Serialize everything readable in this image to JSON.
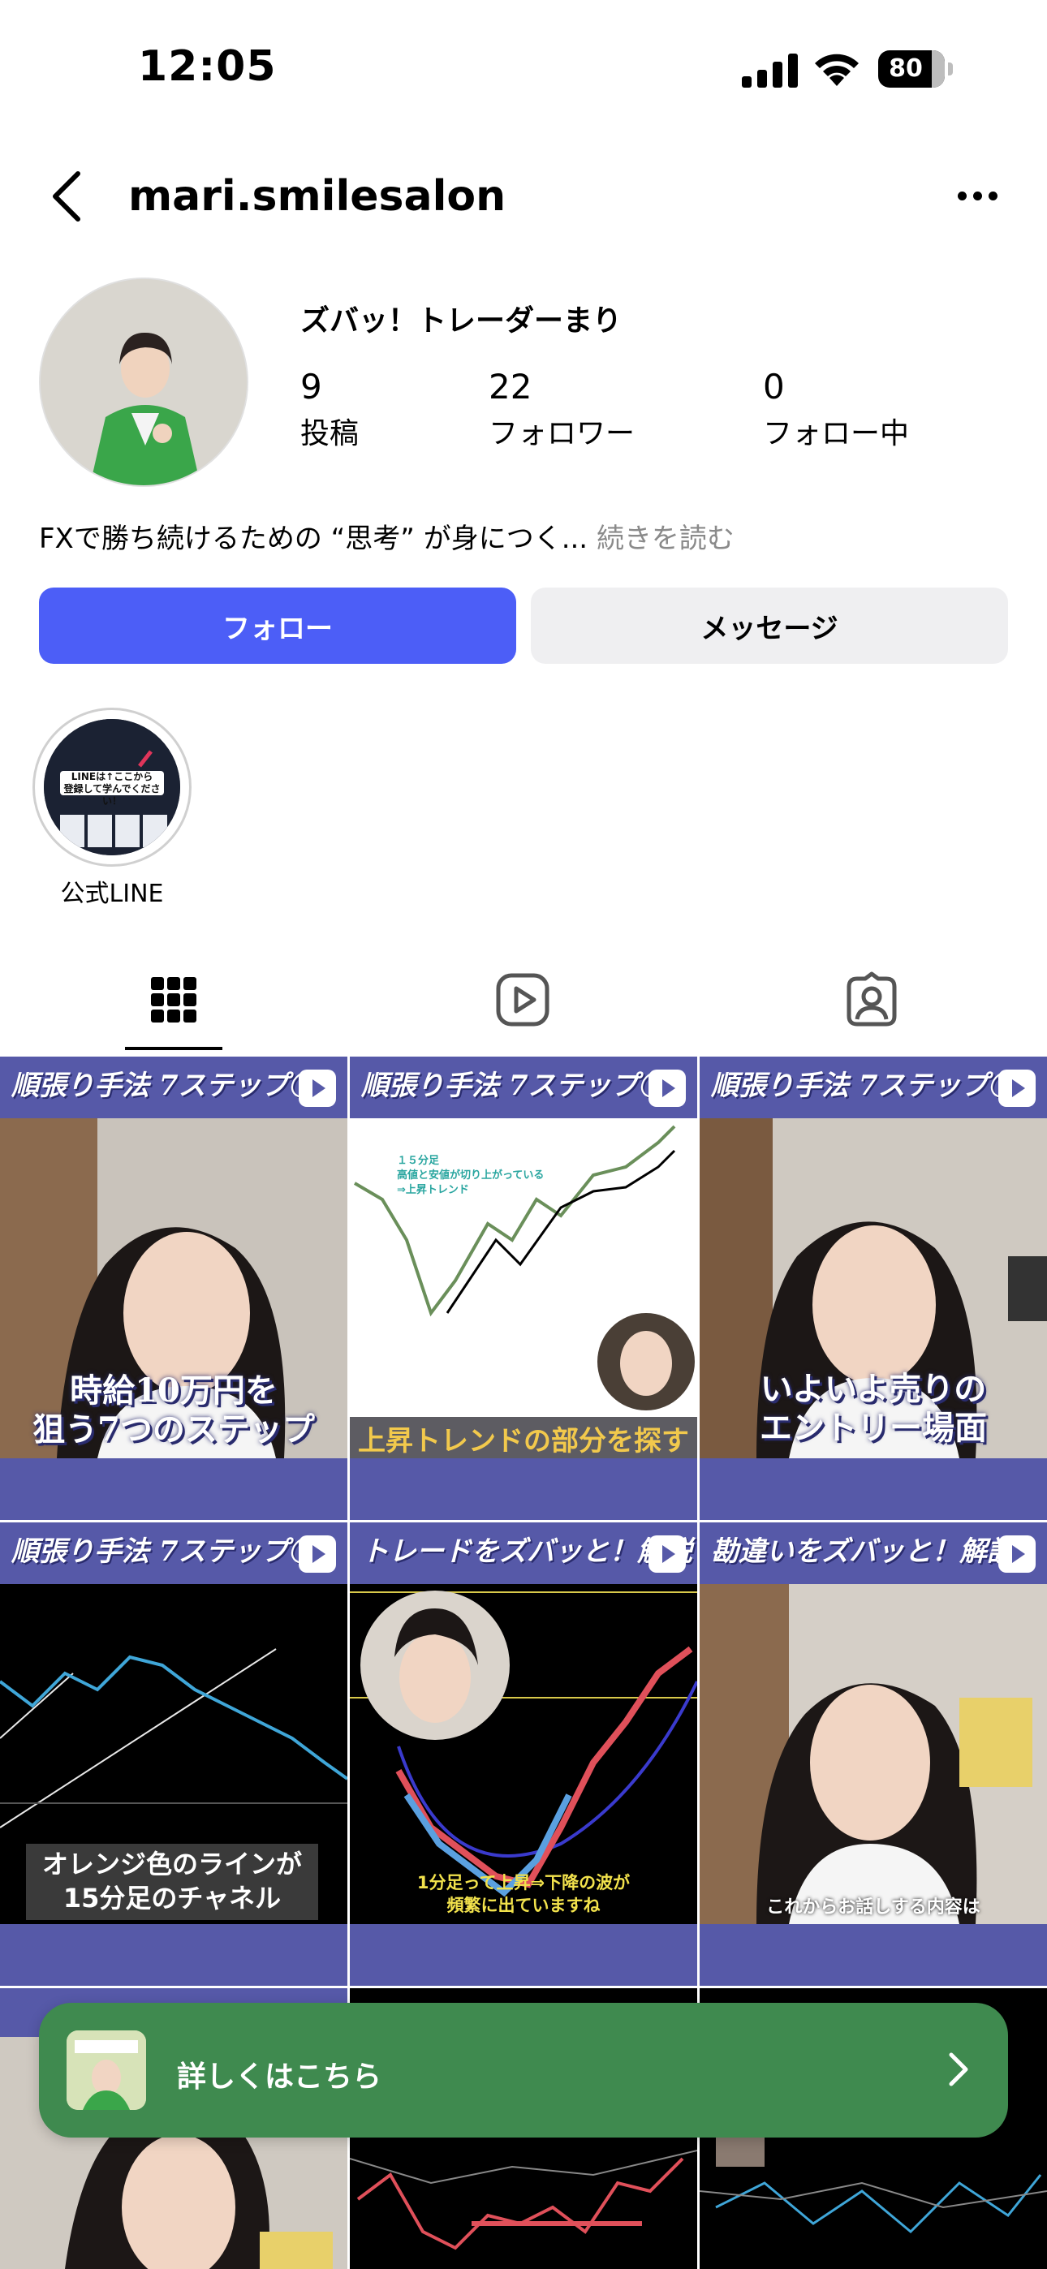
{
  "status_bar": {
    "time": "12:05",
    "battery": "80"
  },
  "header": {
    "username": "mari.smilesalon"
  },
  "profile": {
    "display_name": "ズバッ！トレーダーまり",
    "stats": [
      {
        "value": "9",
        "label": "投稿"
      },
      {
        "value": "22",
        "label": "フォロワー"
      },
      {
        "value": "0",
        "label": "フォロー中"
      }
    ],
    "bio": "FXで勝ち続けるための “思考” が身につく...",
    "bio_more": "続きを読む"
  },
  "actions": {
    "follow": "フォロー",
    "message": "メッセージ"
  },
  "highlight": {
    "label": "公式LINE",
    "cover_text_1": "LINEは↑ここから",
    "cover_text_2": "登録して学んでください！"
  },
  "tabs": [
    {
      "icon": "grid-icon",
      "active": true
    },
    {
      "icon": "reels-icon",
      "active": false
    },
    {
      "icon": "tagged-icon",
      "active": false
    }
  ],
  "posts": [
    {
      "header": "順張り手法 7ステップ①",
      "caption_1": "時給10万円を",
      "caption_2": "狙う7つのステップ"
    },
    {
      "header": "順張り手法 7ステップ①",
      "caption_1": "上昇トレンドの部分を探す",
      "chart_note_1": "１５分足",
      "chart_note_2": "高値と安値が切り上がっている",
      "chart_note_3": "⇒上昇トレンド"
    },
    {
      "header": "順張り手法 7ステップ①",
      "caption_1": "いよいよ売りの",
      "caption_2": "エントリー場面"
    },
    {
      "header": "順張り手法 7ステップ①",
      "caption_1": "オレンジ色のラインが",
      "caption_2": "15分足のチャネル"
    },
    {
      "header": "トレードをズバッと！解説",
      "caption_1": "1分足って上昇⇒下降の波が",
      "caption_2": "頻繁に出ていますね"
    },
    {
      "header": "勘違いをズバッと！解説",
      "caption_1": "これからお話しする内容は"
    }
  ],
  "promo": {
    "label": "詳しくはこちら"
  }
}
